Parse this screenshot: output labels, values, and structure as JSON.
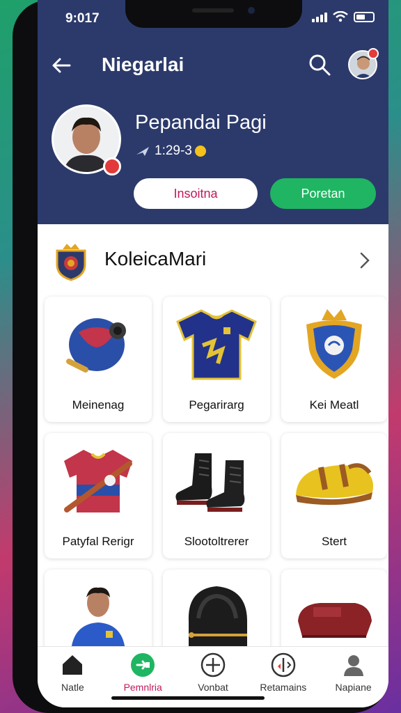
{
  "status_bar": {
    "time": "9:017"
  },
  "header": {
    "title": "Niegarlai",
    "profile": {
      "name": "Pepandai Pagi",
      "stats": "1:29-3"
    },
    "primary_button": "Insoitna",
    "secondary_button": "Poretan"
  },
  "collection": {
    "title": "KoleicaMari",
    "items": [
      {
        "label": "Meinenag",
        "icon": "shield-ball-icon"
      },
      {
        "label": "Pegarirarg",
        "icon": "jersey-icon"
      },
      {
        "label": "Kei Meatl",
        "icon": "crest-badge-icon"
      },
      {
        "label": "Patyfal Rerigr",
        "icon": "shirt-with-bat-icon"
      },
      {
        "label": "Slootoltrerer",
        "icon": "boots-icon"
      },
      {
        "label": "Stert",
        "icon": "yellow-shoe-icon"
      },
      {
        "label": "",
        "icon": "player-icon"
      },
      {
        "label": "",
        "icon": "glove-icon"
      },
      {
        "label": "",
        "icon": "red-cap-icon"
      }
    ]
  },
  "tabbar": [
    {
      "label": "Natle",
      "icon": "home-icon",
      "active": false
    },
    {
      "label": "Pemnlria",
      "icon": "green-circle-icon",
      "active": true
    },
    {
      "label": "Vonbat",
      "icon": "plus-circle-icon",
      "active": false
    },
    {
      "label": "Retamains",
      "icon": "timer-icon",
      "active": false
    },
    {
      "label": "Napiane",
      "icon": "person-icon",
      "active": false
    }
  ],
  "colors": {
    "header_bg": "#2c3a6b",
    "accent_green": "#1fb562",
    "accent_pink": "#c2185b",
    "badge_red": "#e43b3b"
  }
}
